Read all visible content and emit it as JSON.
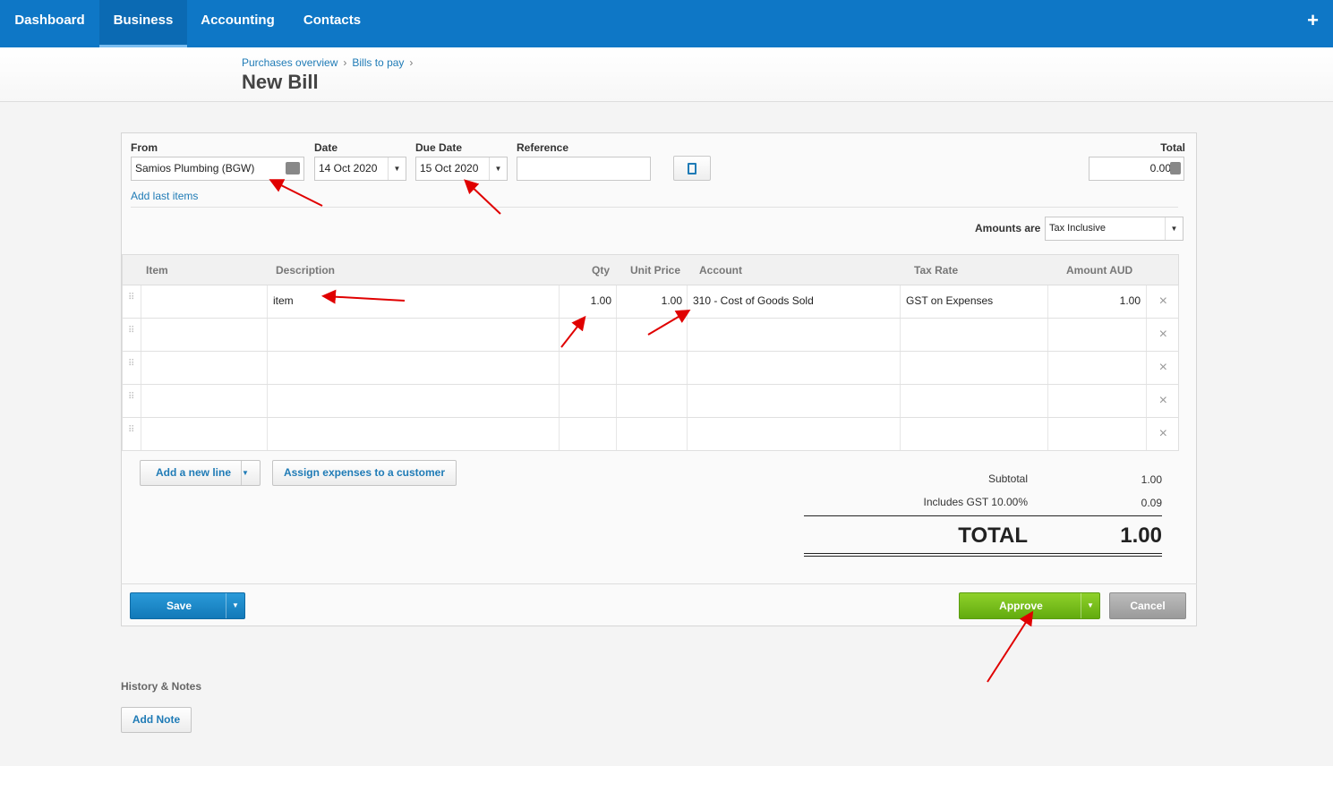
{
  "nav": {
    "items": [
      {
        "label": "Dashboard",
        "active": false
      },
      {
        "label": "Business",
        "active": true
      },
      {
        "label": "Accounting",
        "active": false
      },
      {
        "label": "Contacts",
        "active": false
      }
    ],
    "plus": "+"
  },
  "breadcrumb": [
    "Purchases overview",
    "Bills to pay"
  ],
  "breadcrumb_sep": "›",
  "title": "New Bill",
  "form": {
    "from_label": "From",
    "from_value": "Samios Plumbing (BGW)",
    "date_label": "Date",
    "date_value": "14 Oct 2020",
    "due_label": "Due Date",
    "due_value": "15 Oct 2020",
    "ref_label": "Reference",
    "ref_value": "",
    "total_label": "Total",
    "total_value": "0.00",
    "add_last_items": "Add last items",
    "amounts_are_label": "Amounts are",
    "amounts_are_value": "Tax Inclusive"
  },
  "table": {
    "headers": [
      "Item",
      "Description",
      "Qty",
      "Unit Price",
      "Account",
      "Tax Rate",
      "Amount AUD"
    ],
    "rows": [
      {
        "item": "",
        "description": "item",
        "qty": "1.00",
        "unit_price": "1.00",
        "account": "310 - Cost of Goods Sold",
        "tax_rate": "GST on Expenses",
        "amount": "1.00"
      },
      {
        "item": "",
        "description": "",
        "qty": "",
        "unit_price": "",
        "account": "",
        "tax_rate": "",
        "amount": ""
      },
      {
        "item": "",
        "description": "",
        "qty": "",
        "unit_price": "",
        "account": "",
        "tax_rate": "",
        "amount": ""
      },
      {
        "item": "",
        "description": "",
        "qty": "",
        "unit_price": "",
        "account": "",
        "tax_rate": "",
        "amount": ""
      },
      {
        "item": "",
        "description": "",
        "qty": "",
        "unit_price": "",
        "account": "",
        "tax_rate": "",
        "amount": ""
      }
    ]
  },
  "buttons": {
    "add_line": "Add a new line",
    "assign": "Assign expenses to a customer",
    "save": "Save",
    "approve": "Approve",
    "cancel": "Cancel",
    "add_note": "Add Note"
  },
  "totals": {
    "subtotal_label": "Subtotal",
    "subtotal_value": "1.00",
    "gst_label": "Includes GST 10.00%",
    "gst_value": "0.09",
    "total_label": "TOTAL",
    "total_value": "1.00"
  },
  "history_label": "History & Notes",
  "icons": {
    "delete": "×",
    "dropdown": "▼",
    "drag": "⠿"
  },
  "colors": {
    "nav": "#0e77c6",
    "link": "#1f7bb6",
    "approve": "#7cc11e",
    "save": "#1a88c9",
    "annotation": "#e00000"
  }
}
